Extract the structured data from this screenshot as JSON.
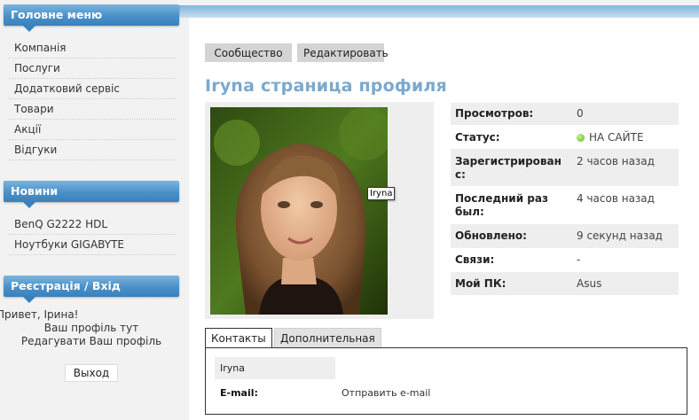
{
  "sidebar": {
    "main_menu": {
      "title": "Головне меню",
      "items": [
        "Компанія",
        "Послуги",
        "Додатковий сервіс",
        "Товари",
        "Акції",
        "Відгуки"
      ]
    },
    "news": {
      "title": "Новини",
      "items": [
        "BenQ G2222 HDL",
        "Ноутбуки GIGABYTE"
      ]
    },
    "login": {
      "title": "Реєстрація / Вхід",
      "greeting": "Привет, Ірина!",
      "profile_link": "Ваш профіль тут",
      "edit_link": "Редагувати Ваш профіль",
      "exit_label": "Выход"
    }
  },
  "main": {
    "buttons": {
      "community": "Сообщество",
      "edit": "Редактировать"
    },
    "title": "Iryna страница профиля",
    "photo_tooltip": "Iryna",
    "info": [
      {
        "label": "Просмотров:",
        "value": "0"
      },
      {
        "label": "Статус:",
        "value": "НА САЙТЕ"
      },
      {
        "label": "Зарегистрирован с:",
        "value": "2 часов назад"
      },
      {
        "label": "Последний раз был:",
        "value": "4 часов назад"
      },
      {
        "label": "Обновлено:",
        "value": "9 секунд назад"
      },
      {
        "label": "Связи:",
        "value": "-"
      },
      {
        "label": "Мой ПК:",
        "value": "Asus"
      }
    ],
    "tabs": {
      "contacts": "Контакты",
      "extra": "Дополнительная информация"
    },
    "contacts": {
      "name": "Iryna",
      "email_label": "E-mail:",
      "email_value": "Отправить e-mail"
    }
  },
  "colors": {
    "accent_blue": "#4a90c8",
    "title_blue": "#7aa9cf",
    "online_green": "#49a81a"
  }
}
